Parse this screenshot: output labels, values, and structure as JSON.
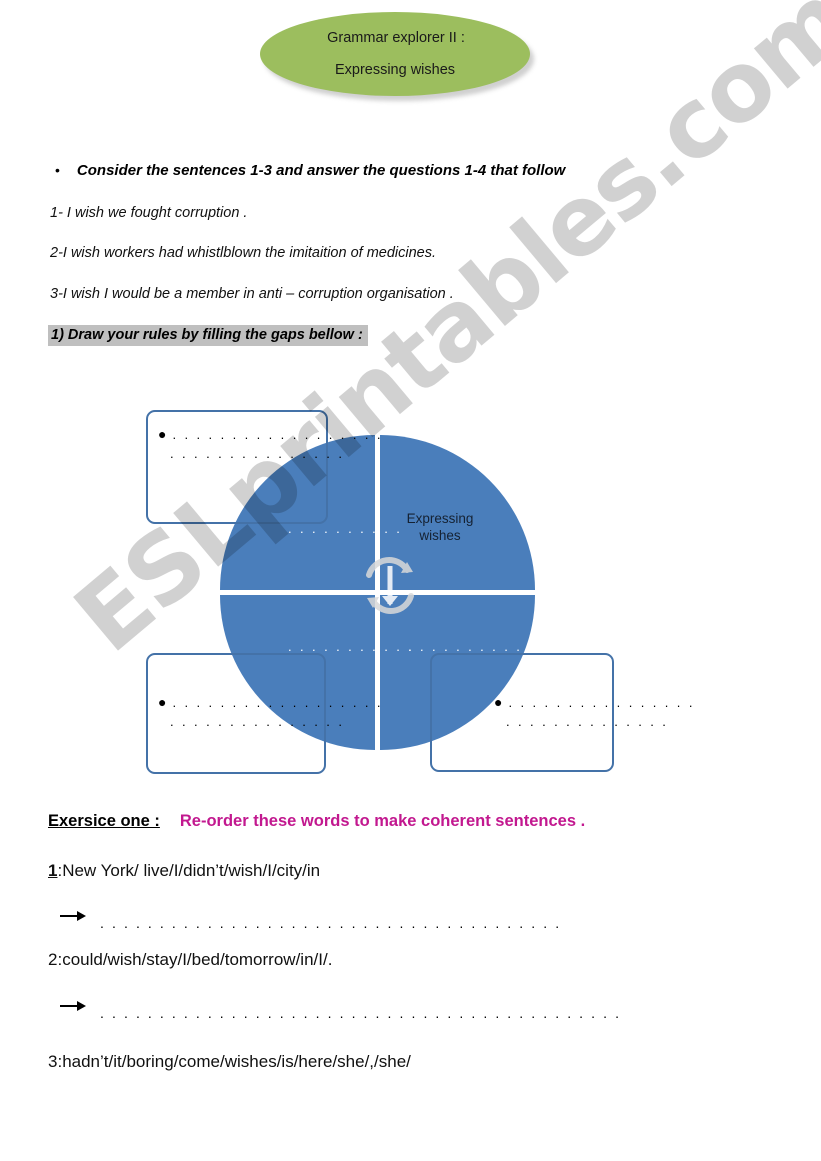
{
  "title_banner": {
    "line1": "Grammar explorer II :",
    "line2": "Expressing wishes",
    "fill_color": "#9CBE5E"
  },
  "instruction": {
    "bullet_glyph": "•",
    "text": "Consider  the sentences 1-3 and  answer  the questions 1-4 that follow"
  },
  "sentences": [
    "1- I  wish we   fought  corruption .",
    "2-I wish workers had  whistlblown  the imitaition of medicines.",
    "3-I  wish  I would be a member in  anti – corruption organisation ."
  ],
  "task_heading": {
    "text": "1)  Draw your rules  by  filling the gaps  bellow :",
    "highlight_color": "#BFBFBF"
  },
  "diagram": {
    "center_label": "Expressing\nwishes",
    "center_label_line1": "Expressing",
    "center_label_line2": "wishes",
    "circle_color": "#4A7EBB",
    "box_border_color": "#4472A8",
    "center_icon": "cycle-arrows-icon",
    "quadrant_dots": {
      "top_left": ". . . . . . . . . .",
      "bottom_left": ". . . . . . . . . . .",
      "bottom_right": ". . . . . . . . . . ."
    },
    "callouts": [
      {
        "position": "top-left",
        "bullet": "●",
        "line1": ". . . . . . . . . . . . . . . . . .",
        "line2": ". . . . . . . . . . . . . . ."
      },
      {
        "position": "bottom-left",
        "bullet": "●",
        "line1": ". . . . . . . . . . . . . . . . . .",
        "line2": ". . . . . . . . . . . . . . ."
      },
      {
        "position": "bottom-right",
        "bullet": "●",
        "line1": ". . . . . . . . . . . . . . . .",
        "line2": ". . . . . . . . . . . . . ."
      }
    ]
  },
  "exercise": {
    "label": "Exersice one :",
    "prompt": "Re-order these words to make coherent sentences .",
    "prompt_color": "#C2188F",
    "questions": [
      {
        "number": "1",
        "number_underlined": true,
        "text": ":New York/ live/I/didn’t/wish/I/city/in",
        "answer_line": ". . . . . . . . . . . . . . . . . . . . . . . . . . . . . . . . . . . . . . ."
      },
      {
        "number": "2",
        "number_underlined": false,
        "text": ":could/wish/stay/I/bed/tomorrow/in/I/.",
        "answer_line": ". . . . . . . . . . . . . . . . . . . . . . . . . . . . . . . . . . . . . . . . . . . ."
      },
      {
        "number": "3",
        "number_underlined": false,
        "text": ":hadn’t/it/boring/come/wishes/is/here/she/,/she/",
        "answer_line": ""
      }
    ]
  },
  "watermark": {
    "text": "ESLprintables.com"
  }
}
